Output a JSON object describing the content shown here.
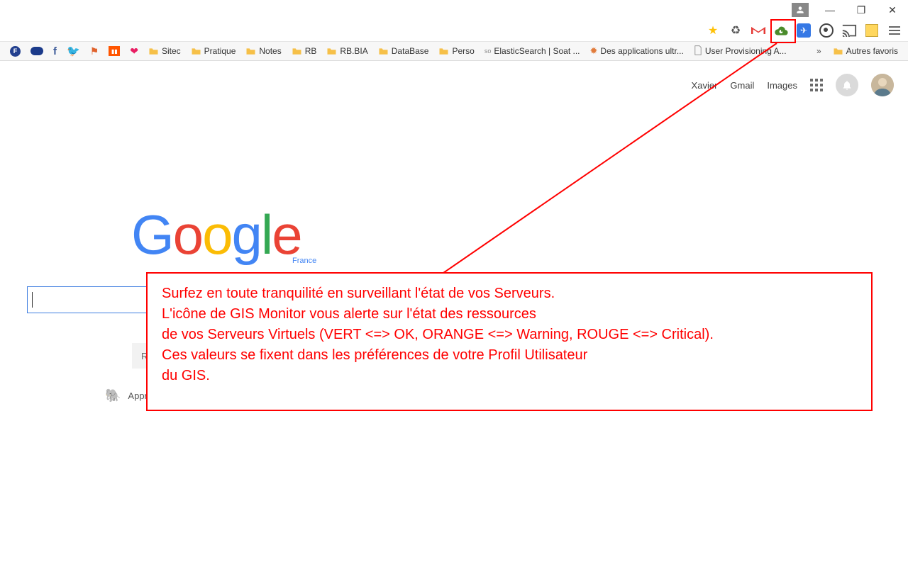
{
  "window": {
    "minimize": "—",
    "maximize": "❐",
    "close": "✕"
  },
  "bookmarks": {
    "items": [
      {
        "type": "icon",
        "name": "feedly"
      },
      {
        "type": "icon",
        "name": "pill"
      },
      {
        "type": "icon",
        "name": "facebook"
      },
      {
        "type": "icon",
        "name": "twitter"
      },
      {
        "type": "icon",
        "name": "flag"
      },
      {
        "type": "icon",
        "name": "soundcloud"
      },
      {
        "type": "icon",
        "name": "heart"
      },
      {
        "type": "folder",
        "label": "Sitec"
      },
      {
        "type": "folder",
        "label": "Pratique"
      },
      {
        "type": "folder",
        "label": "Notes"
      },
      {
        "type": "folder",
        "label": "RB"
      },
      {
        "type": "folder",
        "label": "RB.BIA"
      },
      {
        "type": "folder",
        "label": "DataBase"
      },
      {
        "type": "folder",
        "label": "Perso"
      },
      {
        "type": "page",
        "label": "ElasticSearch | Soat ..."
      },
      {
        "type": "page",
        "label": "Des applications ultr..."
      },
      {
        "type": "page",
        "label": "User Provisioning A..."
      }
    ],
    "more": "»",
    "autres": "Autres favoris"
  },
  "google": {
    "header": {
      "user": "Xavier",
      "gmail": "Gmail",
      "images": "Images"
    },
    "logo": [
      "G",
      "o",
      "o",
      "g",
      "l",
      "e"
    ],
    "subtitle": "France",
    "search_value": "",
    "button": "R",
    "promo": "Appr"
  },
  "annotation": {
    "lines": [
      "Surfez en toute tranquilité en surveillant l'état de vos Serveurs.",
      "L'icône de GIS Monitor vous alerte sur l'état des ressources",
      "de vos Serveurs Virtuels (VERT <=> OK, ORANGE <=> Warning, ROUGE <=> Critical).",
      "Ces valeurs se fixent dans les préférences de votre Profil Utilisateur",
      "du GIS."
    ]
  }
}
